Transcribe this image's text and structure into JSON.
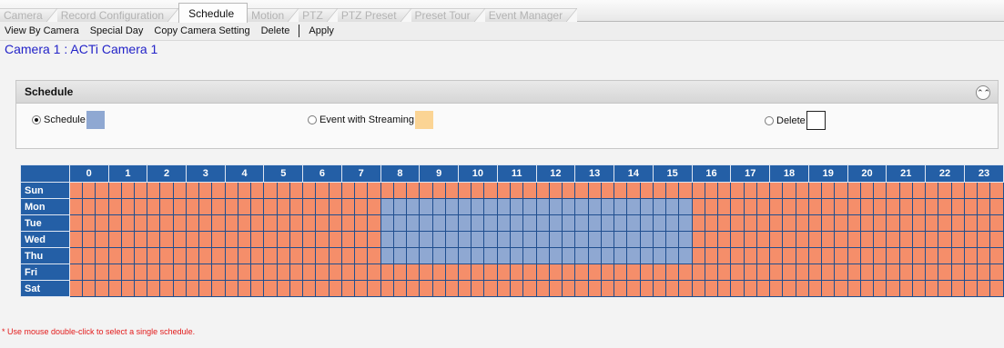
{
  "tabs": [
    "Camera",
    "Record Configuration",
    "Schedule",
    "Motion",
    "PTZ",
    "PTZ Preset",
    "Preset Tour",
    "Event Manager"
  ],
  "active_tab": "Schedule",
  "toolbar": {
    "view_by_camera": "View By Camera",
    "special_day": "Special Day",
    "copy_camera_setting": "Copy Camera Setting",
    "delete": "Delete",
    "apply": "Apply"
  },
  "camera_title": "Camera 1 : ACTi Camera 1",
  "panel": {
    "title": "Schedule",
    "collapse_icon": "double-chevron-up-icon",
    "options": [
      {
        "label": "Schedule",
        "selected": true,
        "color": "#8fa8d2"
      },
      {
        "label": "Event with Streaming",
        "selected": false,
        "color": "#fbd494"
      },
      {
        "label": "Delete",
        "selected": false,
        "color": "#ffffff"
      }
    ]
  },
  "grid": {
    "hours": [
      "0",
      "1",
      "2",
      "3",
      "4",
      "5",
      "6",
      "7",
      "8",
      "9",
      "10",
      "11",
      "12",
      "13",
      "14",
      "15",
      "16",
      "17",
      "18",
      "19",
      "20",
      "21",
      "22",
      "23"
    ],
    "days": [
      "Sun",
      "Mon",
      "Tue",
      "Wed",
      "Thu",
      "Fri",
      "Sat"
    ],
    "schedule_days": [
      "Mon",
      "Tue",
      "Wed",
      "Thu"
    ],
    "schedule_hours": [
      8,
      15
    ],
    "cells_per_hour": 3,
    "colors": {
      "schedule": "#8fa8d2",
      "empty": "#f58e6a",
      "header": "#245fa6"
    }
  },
  "note": "* Use mouse double-click to select a single schedule."
}
